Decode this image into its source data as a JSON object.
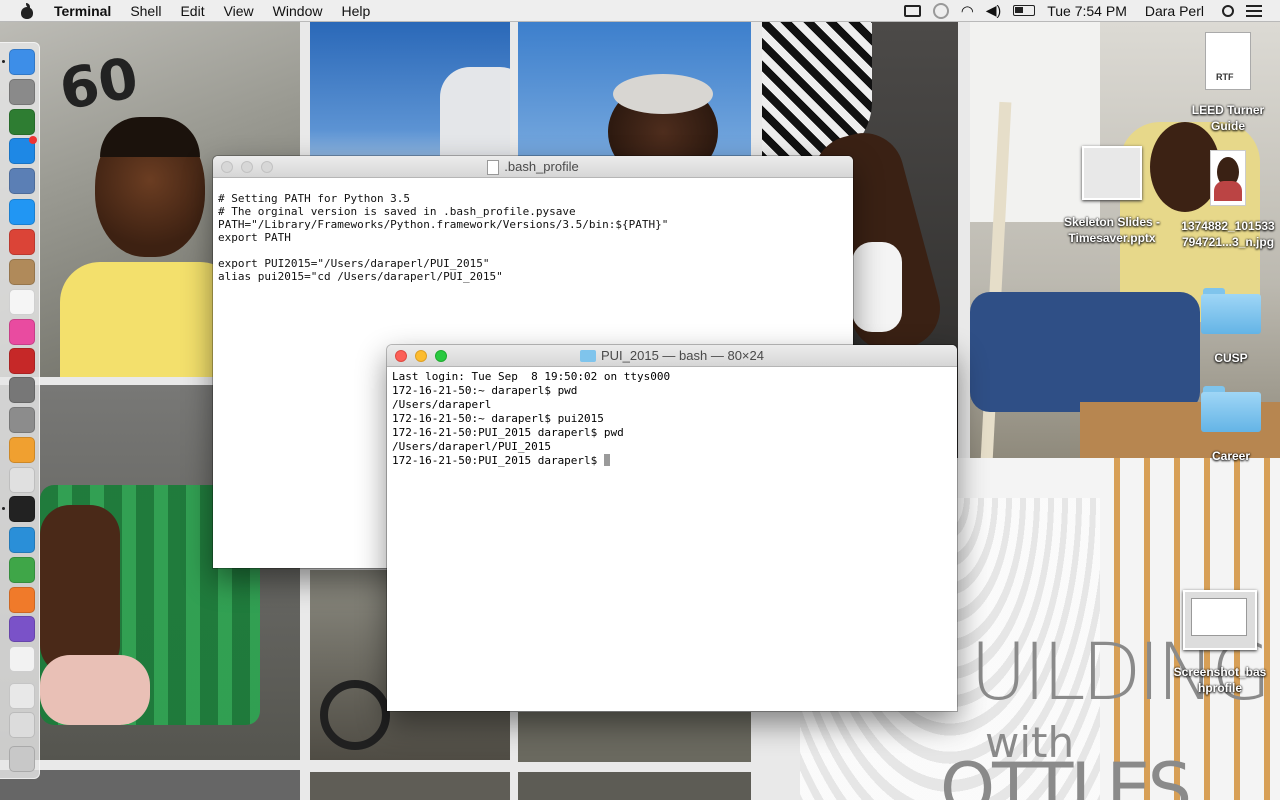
{
  "menubar": {
    "app_name": "Terminal",
    "menus": [
      "Shell",
      "Edit",
      "View",
      "Window",
      "Help"
    ],
    "clock": "Tue 7:54 PM",
    "user": "Dara Perl"
  },
  "dock": {
    "items": [
      {
        "name": "finder-icon",
        "color": "#3d8ee8"
      },
      {
        "name": "launchpad-icon",
        "color": "#8a8a8a"
      },
      {
        "name": "mission-control-icon",
        "color": "#2e7d32"
      },
      {
        "name": "app-store-icon",
        "color": "#1e88e5"
      },
      {
        "name": "preview-icon",
        "color": "#5b7fb5"
      },
      {
        "name": "safari-icon",
        "color": "#2196f3"
      },
      {
        "name": "chrome-icon",
        "color": "#db4437"
      },
      {
        "name": "notes-icon",
        "color": "#b08a5a"
      },
      {
        "name": "calendar-icon",
        "color": "#f5f5f5"
      },
      {
        "name": "itunes-icon",
        "color": "#e94ba0"
      },
      {
        "name": "photo-booth-icon",
        "color": "#c62828"
      },
      {
        "name": "parental-icon",
        "color": "#777777"
      },
      {
        "name": "system-preferences-icon",
        "color": "#8c8c8c"
      },
      {
        "name": "photos-icon",
        "color": "#f0a030"
      },
      {
        "name": "camera-icon",
        "color": "#e0e0e0"
      },
      {
        "name": "terminal-icon",
        "color": "#222222"
      },
      {
        "name": "crown-app-icon",
        "color": "#2a8fd8"
      },
      {
        "name": "green-app-icon",
        "color": "#3fa648"
      },
      {
        "name": "orange-app-icon",
        "color": "#f07a2a"
      },
      {
        "name": "purple-app-icon",
        "color": "#7a52c8"
      },
      {
        "name": "textedit-icon",
        "color": "#f2f2f2"
      },
      {
        "name": "document-stack-icon",
        "color": "#e8e8e8"
      },
      {
        "name": "downloads-stack-icon",
        "color": "#dcdcdc"
      },
      {
        "name": "trash-icon",
        "color": "#c8c8c8"
      }
    ]
  },
  "desktop": {
    "icons": [
      {
        "label": "LEED Turner Guide",
        "kind": "rtf-document",
        "badge": "RTF"
      },
      {
        "label": "Skeleton Slides - Timesaver.pptx",
        "kind": "presentation"
      },
      {
        "label": "1374882_101533 794721...3_n.jpg",
        "kind": "photo"
      },
      {
        "label": "CUSP",
        "kind": "folder"
      },
      {
        "label": "Career",
        "kind": "folder"
      },
      {
        "label": "Screenshot_bas hprofile",
        "kind": "screenshot"
      }
    ]
  },
  "editor_window": {
    "title": ".bash_profile",
    "lines": [
      "# Setting PATH for Python 3.5",
      "# The orginal version is saved in .bash_profile.pysave",
      "PATH=\"/Library/Frameworks/Python.framework/Versions/3.5/bin:${PATH}\"",
      "export PATH",
      "",
      "export PUI2015=\"/Users/daraperl/PUI_2015\"",
      "alias pui2015=\"cd /Users/daraperl/PUI_2015\""
    ]
  },
  "terminal_window": {
    "title": "PUI_2015 — bash — 80×24",
    "lines": [
      "Last login: Tue Sep  8 19:50:02 on ttys000",
      "172-16-21-50:~ daraperl$ pwd",
      "/Users/daraperl",
      "172-16-21-50:~ daraperl$ pui2015",
      "172-16-21-50:PUI_2015 daraperl$ pwd",
      "/Users/daraperl/PUI_2015",
      "172-16-21-50:PUI_2015 daraperl$ "
    ]
  },
  "wallpaper": {
    "tent_number": "60",
    "poster_word_1": "UILDING",
    "poster_word_2": "with",
    "poster_word_3": "OTTLES"
  }
}
